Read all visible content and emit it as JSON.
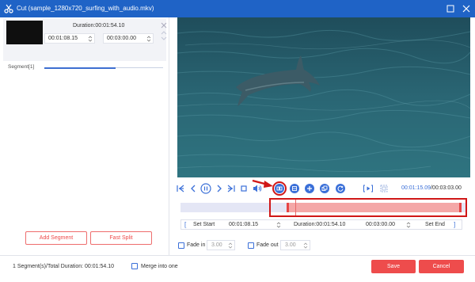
{
  "window": {
    "title": "Cut (sample_1280x720_surfing_with_audio.mkv)",
    "title_color": "#1f63c6"
  },
  "segment": {
    "duration": "Duration:00:01:54.10",
    "start": "00:01:08.15",
    "end": "00:03:00.00",
    "label": "Segment[1]",
    "progress_fraction": 0.6
  },
  "left_buttons": {
    "add_segment": "Add Segment",
    "fast_split": "Fast Split"
  },
  "player": {
    "current_time": "00:01:15.09",
    "total_time": "/00:03:03.00",
    "selection_start_fraction": 0.37,
    "selection_end_fraction": 0.98,
    "playhead_fraction": 0.4
  },
  "range": {
    "set_start": "Set Start",
    "start_value": "00:01:08.15",
    "duration": "Duration:00:01:54.10",
    "end_value": "00:03:00.00",
    "set_end": "Set End"
  },
  "fade": {
    "fade_in_label": "Fade in",
    "fade_in_value": "3.00",
    "fade_out_label": "Fade out",
    "fade_out_value": "3.00"
  },
  "footer": {
    "summary": "1 Segment(s)/Total Duration: 00:01:54.10",
    "merge_label": "Merge into one",
    "save": "Save",
    "cancel": "Cancel"
  },
  "colors": {
    "accent_blue": "#3a6fd8",
    "brand_red": "#ee4c4c",
    "highlight_red": "#d01717"
  },
  "icons": {
    "controls": [
      "first-frame-icon",
      "prev-frame-icon",
      "pause-icon",
      "next-frame-icon",
      "last-frame-icon",
      "stop-icon",
      "volume-icon",
      "split-icon",
      "copy-icon",
      "add-icon",
      "duplicate-icon",
      "reset-icon",
      "preview-icon",
      "crop-icon"
    ]
  }
}
